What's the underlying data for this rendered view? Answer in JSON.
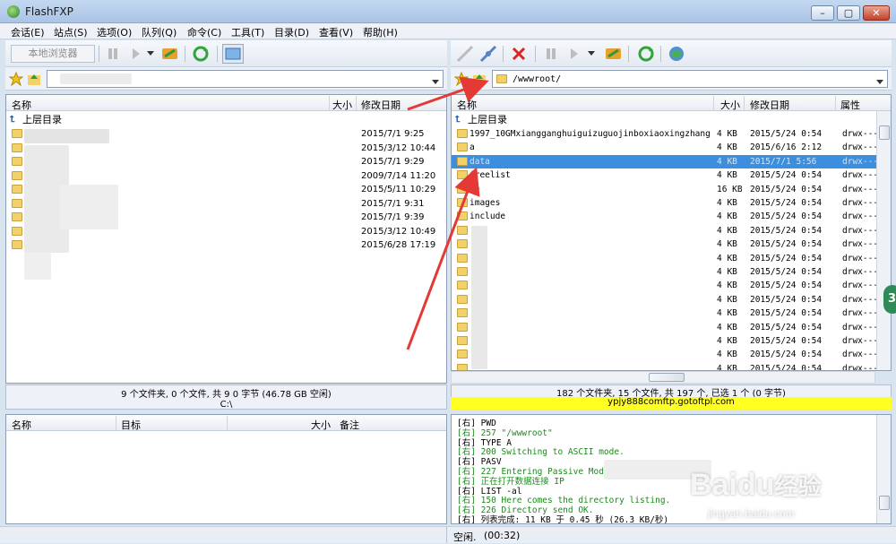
{
  "window": {
    "title": "FlashFXP"
  },
  "menu": [
    "会话(E)",
    "站点(S)",
    "选项(O)",
    "队列(Q)",
    "命令(C)",
    "工具(T)",
    "目录(D)",
    "查看(V)",
    "帮助(H)"
  ],
  "left": {
    "browser_button": "本地浏览器",
    "columns": {
      "name": "名称",
      "size": "大小",
      "date": "修改日期"
    },
    "parent": "上层目录",
    "dates": [
      "2015/7/1 9:25",
      "2015/3/12 10:44",
      "2015/7/1 9:29",
      "2009/7/14 11:20",
      "2015/5/11 10:29",
      "2015/7/1 9:31",
      "2015/7/1 9:39",
      "2015/3/12 10:49",
      "2015/6/28 17:19"
    ],
    "status": "9 个文件夹, 0 个文件, 共 9 0 字节 (46.78 GB 空闲)",
    "path": "C:\\"
  },
  "right": {
    "path": "/wwwroot/",
    "columns": {
      "name": "名称",
      "size": "大小",
      "date": "修改日期",
      "attr": "属性"
    },
    "parent": "上层目录",
    "rows": [
      {
        "name": "1997_10GMxiangganghuiguizuguojinboxiaoxingzhang",
        "size": "4 KB",
        "date": "2015/5/24 0:54",
        "attr": "drwx---"
      },
      {
        "name": "a",
        "size": "4 KB",
        "date": "2015/6/16 2:12",
        "attr": "drwx---"
      },
      {
        "name": "data",
        "size": "4 KB",
        "date": "2015/7/1 5:56",
        "attr": "drwx---"
      },
      {
        "name": "freelist",
        "size": "4 KB",
        "date": "2015/5/24 0:54",
        "attr": "drwx---"
      },
      {
        "name": "he",
        "size": "16 KB",
        "date": "2015/5/24 0:54",
        "attr": "drwx---"
      },
      {
        "name": "images",
        "size": "4 KB",
        "date": "2015/5/24 0:54",
        "attr": "drwx---"
      },
      {
        "name": "include",
        "size": "4 KB",
        "date": "2015/5/24 0:54",
        "attr": "drwx---"
      },
      {
        "name": "",
        "size": "4 KB",
        "date": "2015/5/24 0:54",
        "attr": "drwx---"
      },
      {
        "name": "",
        "size": "4 KB",
        "date": "2015/5/24 0:54",
        "attr": "drwx---"
      },
      {
        "name": "",
        "size": "4 KB",
        "date": "2015/5/24 0:54",
        "attr": "drwx---"
      },
      {
        "name": "",
        "size": "4 KB",
        "date": "2015/5/24 0:54",
        "attr": "drwx---"
      },
      {
        "name": "",
        "size": "4 KB",
        "date": "2015/5/24 0:54",
        "attr": "drwx---"
      },
      {
        "name": "",
        "size": "4 KB",
        "date": "2015/5/24 0:54",
        "attr": "drwx---"
      },
      {
        "name": "",
        "size": "4 KB",
        "date": "2015/5/24 0:54",
        "attr": "drwx---"
      },
      {
        "name": "",
        "size": "4 KB",
        "date": "2015/5/24 0:54",
        "attr": "drwx---"
      },
      {
        "name": "",
        "size": "4 KB",
        "date": "2015/5/24 0:54",
        "attr": "drwx---"
      },
      {
        "name": "",
        "size": "4 KB",
        "date": "2015/5/24 0:54",
        "attr": "drwx---"
      },
      {
        "name": "",
        "size": "4 KB",
        "date": "2015/5/24 0:54",
        "attr": "drwx---"
      }
    ],
    "status": "182 个文件夹, 15 个文件, 共 197 个, 已选 1 个 (0 字节)",
    "host": "ypjy888comftp.gotoftpl.com"
  },
  "queue": {
    "columns": {
      "name": "名称",
      "target": "目标",
      "size": "大小",
      "note": "备注"
    }
  },
  "log": [
    {
      "text": "[右] PWD",
      "green": false
    },
    {
      "text": "[右] 257 \"/wwwroot\"",
      "green": true
    },
    {
      "text": "[右] TYPE A",
      "green": false
    },
    {
      "text": "[右] 200 Switching to ASCII mode.",
      "green": true
    },
    {
      "text": "[右] PASV",
      "green": false
    },
    {
      "text": "[右] 227 Entering Passive Mode",
      "green": true
    },
    {
      "text": "[右] 正在打开数据连接 IP",
      "green": true
    },
    {
      "text": "[右] LIST -al",
      "green": false
    },
    {
      "text": "[右] 150 Here comes the directory listing.",
      "green": true
    },
    {
      "text": "[右] 226 Directory send OK.",
      "green": true
    },
    {
      "text": "[右] 列表完成: 11 KB 于 0.45 秒 (26.3 KB/秒)",
      "green": false
    }
  ],
  "statusbar": {
    "state": "空闲.",
    "time": "(00:32)"
  },
  "watermark": {
    "brand": "Baidu",
    "brand2": "经验",
    "url": "jingyan.baidu.com"
  },
  "side_badge": "3"
}
